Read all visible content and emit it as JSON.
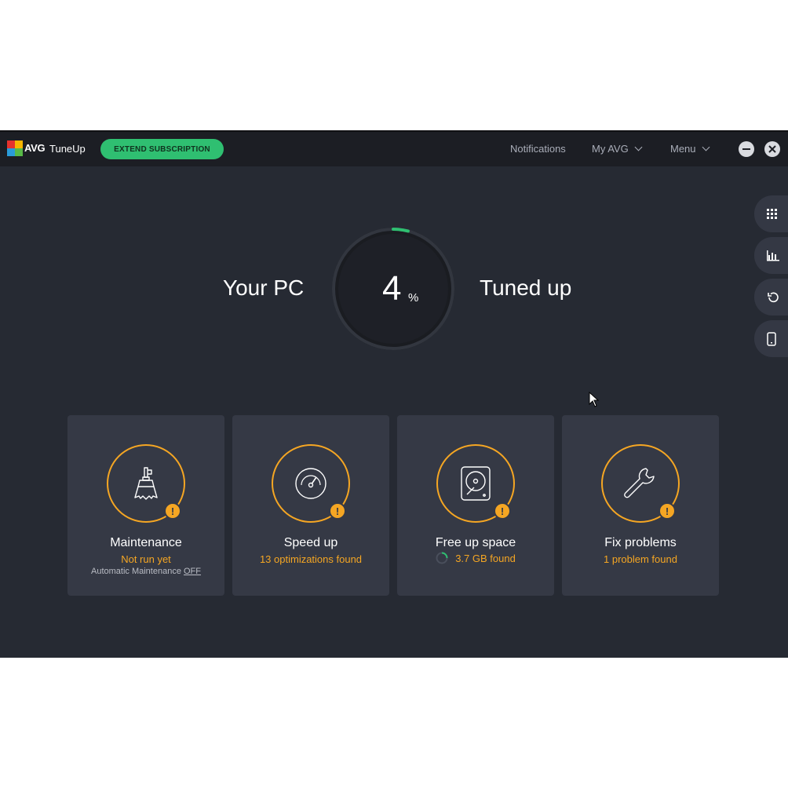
{
  "app": {
    "brand": "AVG",
    "product": "TuneUp",
    "extend_label": "EXTEND SUBSCRIPTION"
  },
  "nav": {
    "notifications": "Notifications",
    "my_avg": "My AVG",
    "menu": "Menu"
  },
  "header": {
    "left": "Your PC",
    "right": "Tuned up",
    "percent_value": "4",
    "percent_symbol": "%",
    "progress": 0.04
  },
  "rail": [
    "apps-grid-icon",
    "stats-chart-icon",
    "history-icon",
    "mobile-icon"
  ],
  "cards": [
    {
      "title": "Maintenance",
      "status": "Not run yet",
      "sub_prefix": "Automatic Maintenance",
      "sub_link": "OFF",
      "icon": "broom-icon"
    },
    {
      "title": "Speed up",
      "status": "13 optimizations found",
      "icon": "speedometer-icon"
    },
    {
      "title": "Free up space",
      "status": "3.7 GB found",
      "icon": "hard-drive-icon"
    },
    {
      "title": "Fix problems",
      "status": "1 problem found",
      "icon": "wrench-icon"
    }
  ],
  "colors": {
    "accent_green": "#2fbf71",
    "warning_orange": "#f5a623",
    "background": "#262a33",
    "card": "#353945"
  }
}
